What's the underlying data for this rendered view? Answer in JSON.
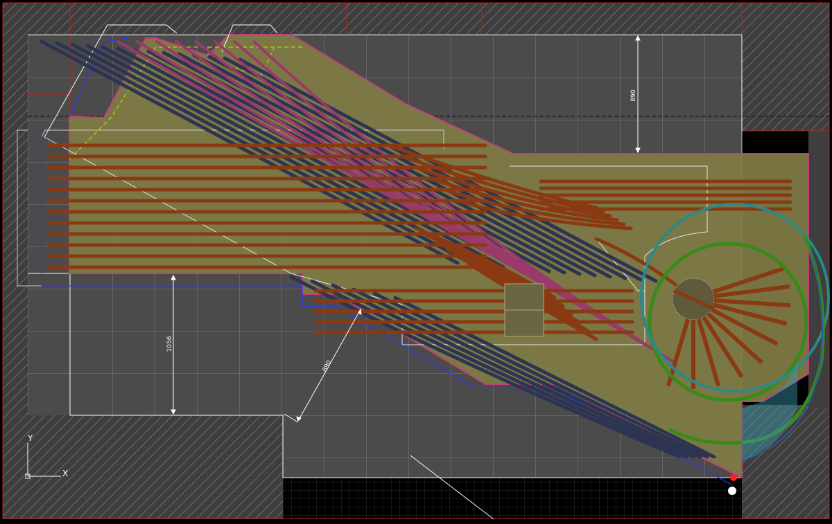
{
  "drawing": {
    "dimensions": [
      {
        "id": "dim-top",
        "value": "890"
      },
      {
        "id": "dim-left",
        "value": "1056"
      },
      {
        "id": "dim-diagonal",
        "value": "890"
      }
    ],
    "ucs": {
      "y_label": "Y",
      "x_label": "X"
    }
  },
  "colors": {
    "background": "#000000",
    "room_floor": "#4b4b4b",
    "hatch": "#8a8a8a",
    "grid": "#9a9a9a",
    "baseboard": "#7d7a45",
    "baseboard_edge": "#c0407a",
    "track_red": "#8a3a12",
    "track_blue": "#2c3452",
    "track_pink": "#9a3a6a",
    "loop_green": "#3a8a1a",
    "loop_teal": "#2a8a8a",
    "outline_white": "#ffffff",
    "outline_blue": "#2a2aff",
    "outline_yellow": "#e0e000",
    "marker_red": "#ff2020"
  },
  "layers": {
    "room": "room-outline",
    "hatching": "wall-hatching",
    "grid": "modular-grid",
    "baseboard": "layout-baseboard",
    "tracks": "track-plan",
    "turntable": "turntable-with-roundhouse",
    "loops": "return-loops"
  }
}
